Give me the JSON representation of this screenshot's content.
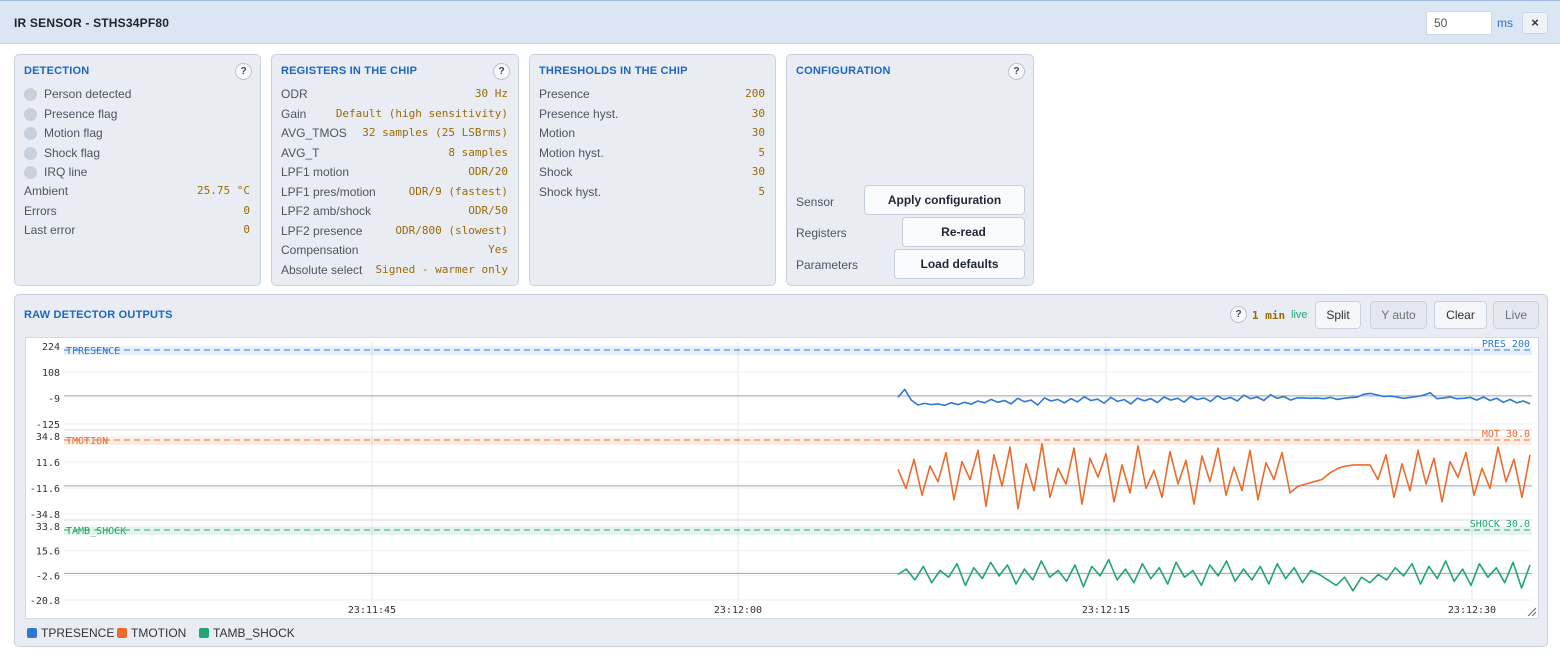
{
  "header": {
    "title": "IR SENSOR - STHS34PF80",
    "interval_value": "50",
    "interval_unit": "ms",
    "close_label": "×"
  },
  "detection": {
    "title": "DETECTION",
    "help": "?",
    "flags": [
      "Person detected",
      "Presence flag",
      "Motion flag",
      "Shock flag",
      "IRQ line"
    ],
    "rows": [
      {
        "label": "Ambient",
        "value": "25.75 °C"
      },
      {
        "label": "Errors",
        "value": "0"
      },
      {
        "label": "Last error",
        "value": "0"
      }
    ]
  },
  "registers": {
    "title": "REGISTERS IN THE CHIP",
    "help": "?",
    "rows": [
      {
        "label": "ODR",
        "value": "30 Hz"
      },
      {
        "label": "Gain",
        "value": "Default (high sensitivity)"
      },
      {
        "label": "AVG_TMOS",
        "value": "32 samples (25 LSBrms)"
      },
      {
        "label": "AVG_T",
        "value": "8 samples"
      },
      {
        "label": "LPF1 motion",
        "value": "ODR/20"
      },
      {
        "label": "LPF1 pres/motion",
        "value": "ODR/9 (fastest)"
      },
      {
        "label": "LPF2 amb/shock",
        "value": "ODR/50"
      },
      {
        "label": "LPF2 presence",
        "value": "ODR/800 (slowest)"
      },
      {
        "label": "Compensation",
        "value": "Yes"
      },
      {
        "label": "Absolute select",
        "value": "Signed - warmer only"
      }
    ]
  },
  "thresholds": {
    "title": "THRESHOLDS IN THE CHIP",
    "rows": [
      {
        "label": "Presence",
        "value": "200"
      },
      {
        "label": "Presence hyst.",
        "value": "30"
      },
      {
        "label": "Motion",
        "value": "30"
      },
      {
        "label": "Motion hyst.",
        "value": "5"
      },
      {
        "label": "Shock",
        "value": "30"
      },
      {
        "label": "Shock hyst.",
        "value": "5"
      }
    ]
  },
  "configuration": {
    "title": "CONFIGURATION",
    "help": "?",
    "sensor_label": "Sensor",
    "apply_button": "Apply configuration",
    "registers_label": "Registers",
    "reread_button": "Re-read",
    "parameters_label": "Parameters",
    "defaults_button": "Load defaults"
  },
  "raw": {
    "title": "RAW DETECTOR OUTPUTS",
    "help": "?",
    "window": "1 min",
    "status": "live",
    "buttons": {
      "split": "Split",
      "yauto": "Y auto",
      "clear": "Clear",
      "live": "Live"
    }
  },
  "colors": {
    "presence": "#2f78d4",
    "motion": "#ec6a2c",
    "shock": "#22a66f",
    "accent": "#1d66c2",
    "value": "#9a6a06"
  },
  "chart_data": {
    "type": "line",
    "x_ticks": [
      "23:11:45",
      "23:12:00",
      "23:12:15",
      "23:12:30"
    ],
    "series": [
      {
        "name": "TPRESENCE",
        "lane_label": "TPRESENCE",
        "threshold_label": "PRES 200",
        "y_ticks": [
          "224",
          "108",
          "-9",
          "-125"
        ],
        "ylim": [
          -125,
          224
        ],
        "threshold": 200,
        "values": [
          -5,
          30,
          -18,
          -40,
          -33,
          -38,
          -35,
          -42,
          -30,
          -38,
          -28,
          -36,
          -22,
          -30,
          -15,
          -28,
          -20,
          -35,
          -10,
          -25,
          -18,
          -40,
          -8,
          -22,
          -15,
          -30,
          -12,
          -26,
          -3,
          -20,
          -14,
          -32,
          -6,
          -24,
          -16,
          -35,
          -9,
          -21,
          -12,
          -29,
          -4,
          -18,
          -10,
          -27,
          -2,
          -16,
          -8,
          -24,
          1,
          -15,
          -6,
          -22,
          4,
          -12,
          -4,
          -20,
          6,
          -10,
          -2,
          -18,
          -8,
          -8,
          -10,
          -9,
          -12,
          -6,
          -15,
          -10,
          -7,
          -5,
          8,
          12,
          5,
          -2,
          0,
          -4,
          -10,
          -6,
          -2,
          4,
          15,
          -12,
          -8,
          -4,
          -12,
          -10,
          -6,
          -18,
          -4,
          -20,
          -10,
          -28,
          -15,
          -30,
          -22,
          -35
        ]
      },
      {
        "name": "TMOTION",
        "lane_label": "TMOTION",
        "threshold_label": "MOT 30.0",
        "y_ticks": [
          "34.8",
          "11.6",
          "-11.6",
          "-34.8"
        ],
        "ylim": [
          -34.8,
          34.8
        ],
        "threshold": 30,
        "values": [
          5,
          -12,
          14,
          -18,
          8,
          -6,
          20,
          -22,
          12,
          -4,
          22,
          -28,
          18,
          -10,
          25,
          -30,
          10,
          -14,
          28,
          -20,
          6,
          -8,
          24,
          -26,
          15,
          -2,
          19,
          -24,
          9,
          -16,
          26,
          -12,
          4,
          -20,
          21,
          -8,
          13,
          -26,
          17,
          -6,
          24,
          -18,
          7,
          -14,
          22,
          -22,
          11,
          -4,
          20,
          -16,
          -10,
          -8,
          -6,
          -4,
          2,
          6,
          8,
          9,
          9,
          9,
          -4,
          18,
          -20,
          10,
          -14,
          22,
          -8,
          15,
          -24,
          12,
          -2,
          20,
          -18,
          6,
          -12,
          25,
          -6,
          14,
          -20,
          18
        ]
      },
      {
        "name": "TAMB_SHOCK",
        "lane_label": "TAMB_SHOCK",
        "threshold_label": "SHOCK 30.0",
        "y_ticks": [
          "33.8",
          "15.6",
          "-2.6",
          "-20.8"
        ],
        "ylim": [
          -20.8,
          33.8
        ],
        "threshold": 30,
        "values": [
          -2,
          2,
          -6,
          4,
          -8,
          1,
          -4,
          6,
          -10,
          3,
          -5,
          7,
          -3,
          5,
          -9,
          2,
          -6,
          8,
          -4,
          1,
          -7,
          5,
          -11,
          4,
          -3,
          9,
          -6,
          2,
          -8,
          6,
          -5,
          3,
          -9,
          7,
          -4,
          1,
          -10,
          5,
          -3,
          8,
          -7,
          2,
          -6,
          4,
          -9,
          6,
          -5,
          3,
          -8,
          1,
          -2,
          -6,
          -10,
          -4,
          -14,
          -4,
          -8,
          -2,
          -6,
          3,
          -3,
          6,
          -9,
          4,
          -5,
          8,
          -7,
          2,
          -10,
          6,
          -4,
          3,
          -8,
          7,
          -12,
          5
        ]
      }
    ]
  },
  "legend": [
    "TPRESENCE",
    "TMOTION",
    "TAMB_SHOCK"
  ]
}
